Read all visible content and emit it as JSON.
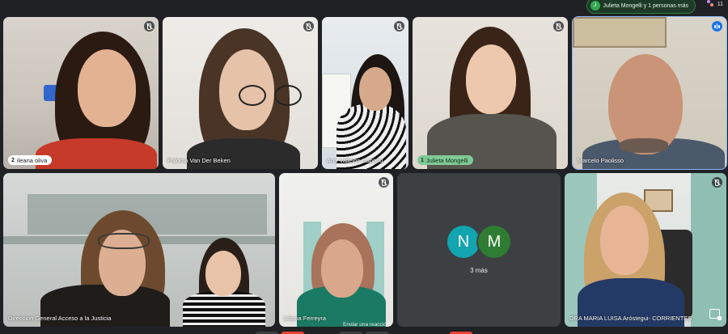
{
  "activity": {
    "pill_text": "Julieta Mongelli y 1 personas más",
    "participant_count": "11"
  },
  "tiles": [
    {
      "name": "ileana oliva",
      "badge": "2",
      "label_style": "pill-white"
    },
    {
      "name": "Paloma Van Der Beken"
    },
    {
      "name": "Ana Vallejos Caporio"
    },
    {
      "name": "Julieta Mongelli",
      "badge": "1",
      "label_style": "pill-green"
    },
    {
      "name": "Marcelo Paolisso",
      "status": "speaking"
    },
    {
      "name": "Direccion General Acceso a la Justicia"
    },
    {
      "name": "Liliana Ferreyra"
    },
    {
      "name": "3 más",
      "initials": [
        "N",
        "M"
      ],
      "colors": [
        "#12a4af",
        "#2e7d32"
      ]
    },
    {
      "name": "DRA MARIA LUISA Aróstegui- CORRIENTES"
    }
  ],
  "reaction_tooltip": "Enviar una reacción",
  "icons": {
    "mic_off": "mic-off-icon",
    "speaking": "audio-level-icon",
    "pin": "pin-icon",
    "people": "people-icon"
  },
  "colors": {
    "background": "#202124",
    "tile": "#3c4043",
    "active_outline": "#8ab4f8",
    "speaking_blue": "#1a73e8"
  }
}
